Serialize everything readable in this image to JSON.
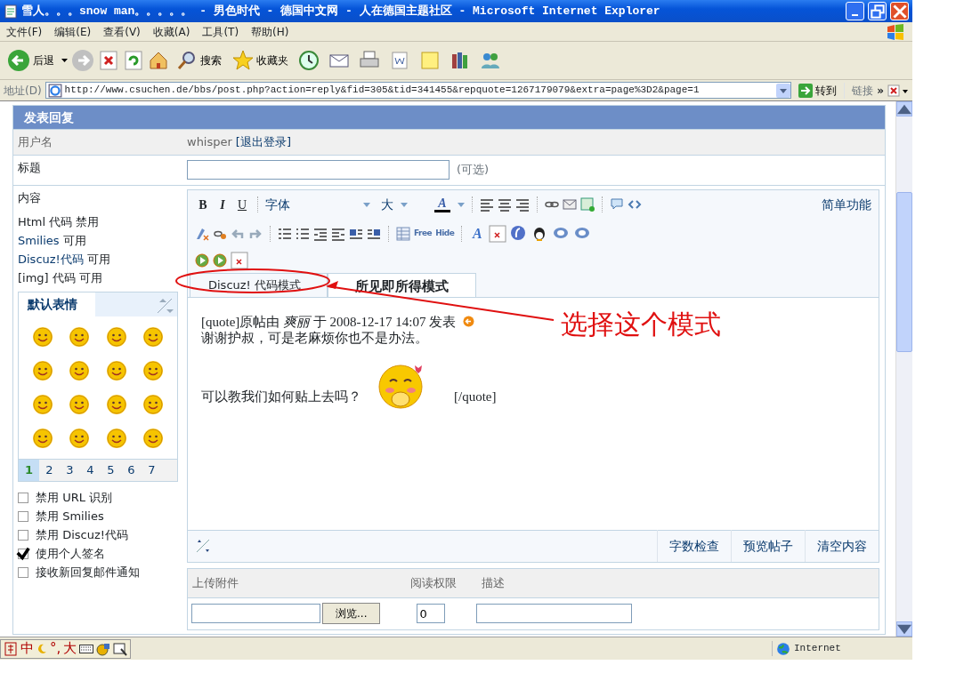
{
  "window": {
    "title": "雪人。。。snow man。。。。。 - 男色时代 - 德国中文网 - 人在德国主题社区 - Microsoft Internet Explorer"
  },
  "menu": [
    "文件(F)",
    "编辑(E)",
    "查看(V)",
    "收藏(A)",
    "工具(T)",
    "帮助(H)"
  ],
  "toolbar": {
    "back": "后退",
    "search": "搜索",
    "favorites": "收藏夹"
  },
  "address": {
    "label": "地址(D)",
    "url": "http://www.csuchen.de/bbs/post.php?action=reply&fid=305&tid=341455&repquote=1267179079&extra=page%3D2&page=1",
    "go": "转到",
    "links": "链接",
    "more": "»"
  },
  "form": {
    "heading": "发表回复",
    "username_label": "用户名",
    "username": "whisper",
    "logout": "[退出登录]",
    "subject_label": "标题",
    "subject_hint": "(可选)",
    "content_label": "内容",
    "permissions": [
      {
        "name": "Html",
        "rest": "代码 禁用",
        "link": false
      },
      {
        "name": "Smilies",
        "rest": "可用",
        "link": true
      },
      {
        "name": "Discuz!代码",
        "rest": "可用",
        "link": true
      },
      {
        "name": "[img]",
        "rest": "代码 可用",
        "link": false
      }
    ],
    "smilies": {
      "title": "默认表情",
      "pages": [
        {
          "label": "1",
          "selected": true
        },
        {
          "label": "2",
          "selected": false
        },
        {
          "label": "3",
          "selected": false
        },
        {
          "label": "4",
          "selected": false
        },
        {
          "label": "5",
          "selected": false
        },
        {
          "label": "6",
          "selected": false
        },
        {
          "label": "7",
          "selected": false
        }
      ]
    },
    "options": [
      {
        "label": "禁用 URL 识别",
        "checked": false
      },
      {
        "label": "禁用 Smilies",
        "checked": false
      },
      {
        "label": "禁用 Discuz!代码",
        "checked": false
      },
      {
        "label": "使用个人签名",
        "checked": true
      },
      {
        "label": "接收新回复邮件通知",
        "checked": false
      }
    ]
  },
  "editor": {
    "format_buttons": [
      "B",
      "I",
      "U"
    ],
    "font": "字体",
    "size": "大",
    "color_button": "A",
    "simple_mode": "简单功能",
    "tag_buttons": [
      "Free",
      "Hide"
    ],
    "effect_button": "A",
    "tabs": [
      {
        "label": "Discuz! 代码模式",
        "selected": false
      },
      {
        "label": "所见即所得模式",
        "selected": true
      }
    ],
    "content": {
      "quote_line": "[quote]原帖由 *爽丽* 于  2008-12-17 14:07 发表",
      "line_2": "谢谢护叔，可是老麻烦你也不是办法。",
      "line_3": "可以教我们如何贴上去吗？",
      "quote_end": "[/quote]"
    },
    "footer_buttons": [
      "字数检查",
      "预览帖子",
      "清空内容"
    ]
  },
  "attachments": {
    "columns": [
      "上传附件",
      "阅读权限",
      "描述"
    ],
    "browse": "浏览...",
    "permission": "0"
  },
  "annotation": {
    "text": "选择这个模式"
  },
  "ime": [
    "中",
    "°,",
    "大"
  ],
  "status_bar": {
    "zone": "Internet"
  }
}
